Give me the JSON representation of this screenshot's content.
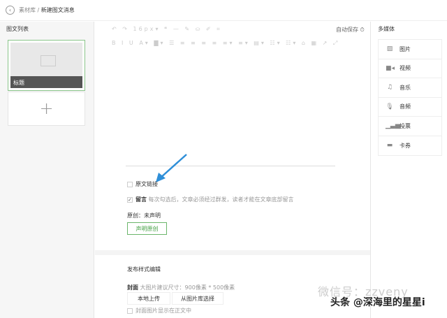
{
  "header": {
    "back_icon": "chevron-left-icon",
    "crumb_parent": "素材库",
    "separator": "/",
    "crumb_current": "新建图文消息"
  },
  "left": {
    "title": "图文列表",
    "article_title": "标题",
    "add_symbol": "+"
  },
  "editor": {
    "toolbar1": "↶ ↷ 16px▾ ❝ — ✎ ⛀ ✐ ⌗",
    "toolbar2": "B I U A▾ ▇▾ ☰ ≡ ≡ ≡ ≡ ≡▾ ≡▾ ▤▾ ☷▾ ☷▾ ⌂ ▦ ↗ ⤢",
    "autosave": "自动保存 ⏱",
    "original_link": "原文链接",
    "comment_label": "留言",
    "comment_hint": "每次勾选后，文章必须经过群发，读者才能在文章底部留言",
    "comment_checked": true,
    "original_state": "原创：未声明",
    "declare_button": "声明原创"
  },
  "publish": {
    "title": "发布样式编辑",
    "cover_label": "封面",
    "cover_hint": "大图片建议尺寸：900像素 * 500像素",
    "upload_button": "本地上传",
    "library_button": "从图片库选择",
    "show_cover": "封面图片显示在正文中"
  },
  "media": {
    "title": "多媒体",
    "items": [
      {
        "label": "图片",
        "icon": "image-icon",
        "glyph": "▨"
      },
      {
        "label": "视频",
        "icon": "video-icon",
        "glyph": "■◂"
      },
      {
        "label": "音乐",
        "icon": "music-icon",
        "glyph": "♫"
      },
      {
        "label": "音频",
        "icon": "microphone-icon",
        "glyph": "🎙"
      },
      {
        "label": "投票",
        "icon": "bar-chart-icon",
        "glyph": "▁▃▅"
      },
      {
        "label": "卡券",
        "icon": "ticket-icon",
        "glyph": "▬"
      }
    ]
  },
  "watermark": {
    "wechat": "微信号：zzveny",
    "toutiao": "头条 @深海里的星星i"
  }
}
